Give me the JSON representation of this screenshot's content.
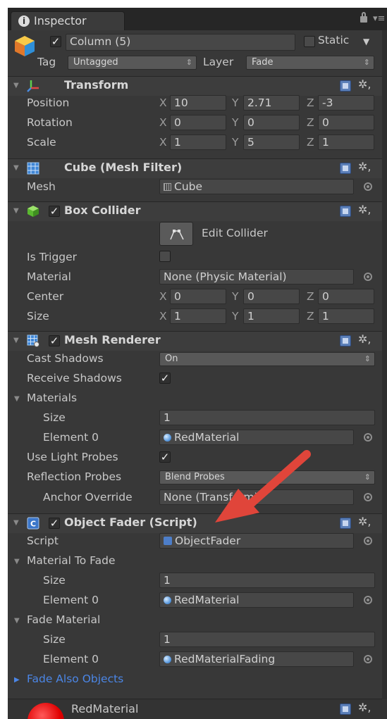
{
  "window": {
    "tab_title": "Inspector",
    "info_glyph": "i",
    "tab_menu_glyph": "▾≡"
  },
  "object": {
    "name": "Column (5)",
    "active": true,
    "static_label": "Static",
    "tag_label": "Tag",
    "tag_value": "Untagged",
    "layer_label": "Layer",
    "layer_value": "Fade"
  },
  "transform": {
    "title": "Transform",
    "rows": [
      {
        "label": "Position",
        "x": "10",
        "y": "2.71",
        "z": "-3"
      },
      {
        "label": "Rotation",
        "x": "0",
        "y": "0",
        "z": "0"
      },
      {
        "label": "Scale",
        "x": "1",
        "y": "5",
        "z": "1"
      }
    ],
    "axis": {
      "x": "X",
      "y": "Y",
      "z": "Z"
    }
  },
  "mesh_filter": {
    "title": "Cube (Mesh Filter)",
    "mesh_label": "Mesh",
    "mesh_value": "Cube"
  },
  "box_collider": {
    "title": "Box Collider",
    "enabled": true,
    "edit_collider_label": "Edit Collider",
    "is_trigger_label": "Is Trigger",
    "material_label": "Material",
    "material_value": "None (Physic Material)",
    "center_label": "Center",
    "center": {
      "x": "0",
      "y": "0",
      "z": "0"
    },
    "size_label": "Size",
    "size": {
      "x": "1",
      "y": "1",
      "z": "1"
    }
  },
  "mesh_renderer": {
    "title": "Mesh Renderer",
    "enabled": true,
    "cast_shadows_label": "Cast Shadows",
    "cast_shadows_value": "On",
    "receive_shadows_label": "Receive Shadows",
    "materials_label": "Materials",
    "size_label": "Size",
    "size_value": "1",
    "element0_label": "Element 0",
    "element0_value": "RedMaterial",
    "use_light_probes_label": "Use Light Probes",
    "reflection_probes_label": "Reflection Probes",
    "reflection_probes_value": "Blend Probes",
    "anchor_override_label": "Anchor Override",
    "anchor_override_value": "None (Transform)"
  },
  "object_fader": {
    "title": "Object Fader (Script)",
    "enabled": true,
    "script_label": "Script",
    "script_value": "ObjectFader",
    "material_to_fade_label": "Material To Fade",
    "mtf_size_label": "Size",
    "mtf_size_value": "1",
    "mtf_element0_label": "Element 0",
    "mtf_element0_value": "RedMaterial",
    "fade_material_label": "Fade Material",
    "fm_size_label": "Size",
    "fm_size_value": "1",
    "fm_element0_label": "Element 0",
    "fm_element0_value": "RedMaterialFading",
    "fade_also_objects_label": "Fade Also Objects"
  },
  "material_preview": {
    "name": "RedMaterial"
  },
  "glyphs": {
    "check": "✓",
    "expanded": "▼",
    "collapsed": "▶",
    "dropdown": "⇕",
    "gear": "✲,"
  },
  "colors": {
    "panel_bg": "#383838",
    "header_bg": "#3d3d3d",
    "field_bg": "#474747",
    "text": "#c8c8c8",
    "link_blue": "#4b86e6",
    "arrow_red": "#e0453a"
  }
}
